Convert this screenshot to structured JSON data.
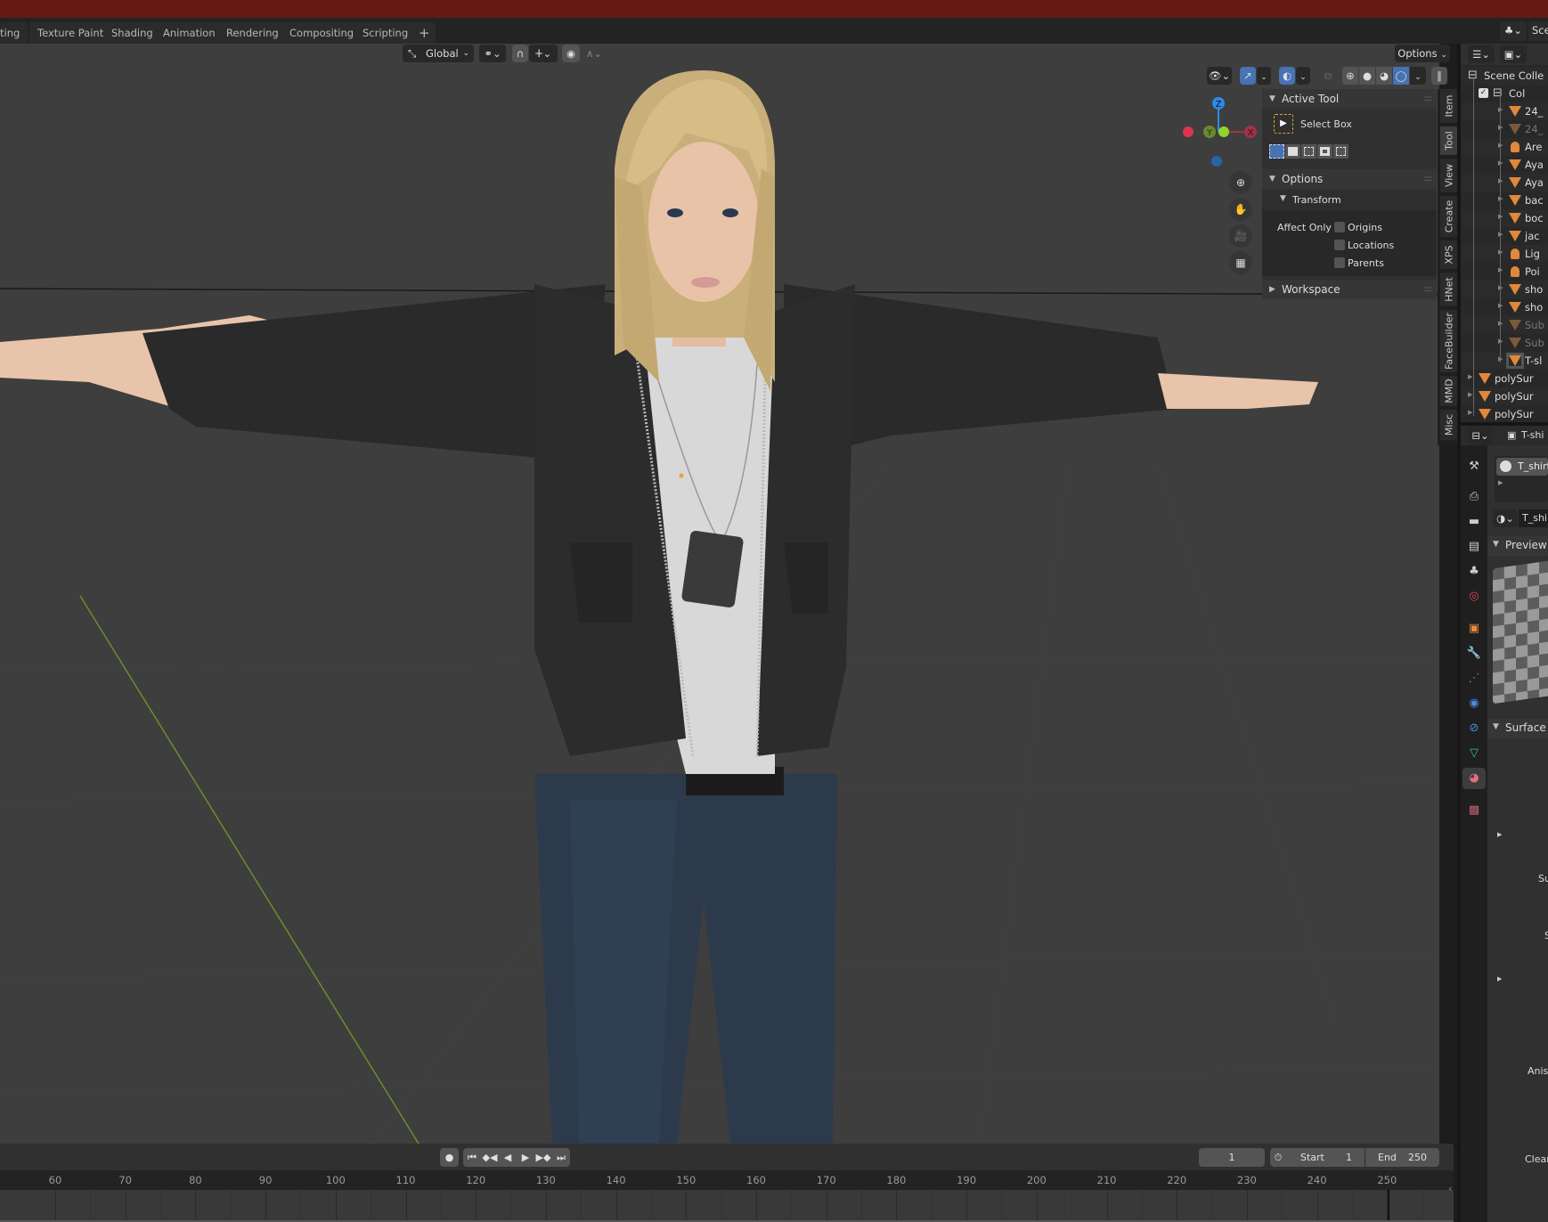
{
  "window": {
    "title_bar_color": "#661914"
  },
  "workspace_tabs": [
    {
      "label": "ting"
    },
    {
      "label": "Texture Paint"
    },
    {
      "label": "Shading"
    },
    {
      "label": "Animation"
    },
    {
      "label": "Rendering"
    },
    {
      "label": "Compositing"
    },
    {
      "label": "Scripting"
    },
    {
      "label": "+"
    }
  ],
  "scene_selector": {
    "label": "Sce"
  },
  "viewport_header": {
    "transform_orientation": "Global",
    "options_label": "Options",
    "icons": [
      "transform-orientation-icon",
      "pivot-point-icon",
      "snap-icon",
      "snap-increment-icon",
      "proportional-edit-icon",
      "falloff-icon"
    ]
  },
  "viewport_overlays": {
    "shading_modes": [
      "wireframe",
      "solid",
      "material-preview",
      "rendered"
    ],
    "active_shading": "rendered"
  },
  "nav_gizmo": {
    "axes": [
      "X",
      "Y",
      "Z"
    ],
    "colors": {
      "x": "#e0334f",
      "y": "#7ea62b",
      "z": "#2e8ae6"
    }
  },
  "viewport_nav_buttons": [
    "zoom-icon",
    "hand-pan-icon",
    "camera-icon",
    "ortho-grid-icon"
  ],
  "npanel": {
    "tabs": [
      "Item",
      "Tool",
      "View",
      "Create",
      "XPS",
      "HNet",
      "FaceBuilder",
      "MMD",
      "Misc"
    ],
    "active_tab": "Tool",
    "active_tool": {
      "header": "Active Tool",
      "tool_name": "Select Box"
    },
    "options": {
      "header": "Options",
      "transform": {
        "header": "Transform",
        "affect_only_label": "Affect Only",
        "checkboxes": [
          {
            "label": "Origins",
            "checked": false
          },
          {
            "label": "Locations",
            "checked": false
          },
          {
            "label": "Parents",
            "checked": false
          }
        ]
      }
    },
    "workspace": {
      "header": "Workspace"
    }
  },
  "outliner": {
    "items": [
      {
        "label": "Scene Colle",
        "type": "scene-collection"
      },
      {
        "label": "Col",
        "type": "collection"
      },
      {
        "label": "24_",
        "type": "mesh"
      },
      {
        "label": "24_",
        "type": "mesh",
        "dim": true
      },
      {
        "label": "Are",
        "type": "light"
      },
      {
        "label": "Aya",
        "type": "mesh"
      },
      {
        "label": "Aya",
        "type": "mesh"
      },
      {
        "label": "bac",
        "type": "mesh"
      },
      {
        "label": "boc",
        "type": "mesh"
      },
      {
        "label": "jac",
        "type": "mesh"
      },
      {
        "label": "Lig",
        "type": "light"
      },
      {
        "label": "Poi",
        "type": "light"
      },
      {
        "label": "sho",
        "type": "mesh"
      },
      {
        "label": "sho",
        "type": "mesh"
      },
      {
        "label": "Sub",
        "type": "mesh",
        "dim": true
      },
      {
        "label": "Sub",
        "type": "mesh",
        "dim": true
      },
      {
        "label": "T-sl",
        "type": "mesh",
        "selected": true
      },
      {
        "label": "polySur",
        "type": "mesh"
      },
      {
        "label": "polySur",
        "type": "mesh"
      },
      {
        "label": "polySur",
        "type": "mesh"
      }
    ]
  },
  "properties": {
    "header_object": "T-shi",
    "material_slot": "T_shirt",
    "material_name": "T_shi",
    "sections": {
      "preview": "Preview",
      "surface": "Surface"
    },
    "partial_labels": [
      "Su",
      "S",
      "Anisc",
      "Clear"
    ],
    "tabs": [
      "tool",
      "render",
      "output",
      "view-layer",
      "scene",
      "world",
      "object",
      "modifier",
      "particles",
      "physics",
      "constraints",
      "data",
      "material",
      "texture"
    ],
    "active_tab": "material"
  },
  "timeline": {
    "current_frame": "1",
    "start_label": "Start",
    "start_value": "1",
    "end_label": "End",
    "end_value": "250",
    "ruler_ticks": [
      "60",
      "70",
      "80",
      "90",
      "100",
      "110",
      "120",
      "130",
      "140",
      "150",
      "160",
      "170",
      "180",
      "190",
      "200",
      "210",
      "220",
      "230",
      "240",
      "250"
    ]
  }
}
